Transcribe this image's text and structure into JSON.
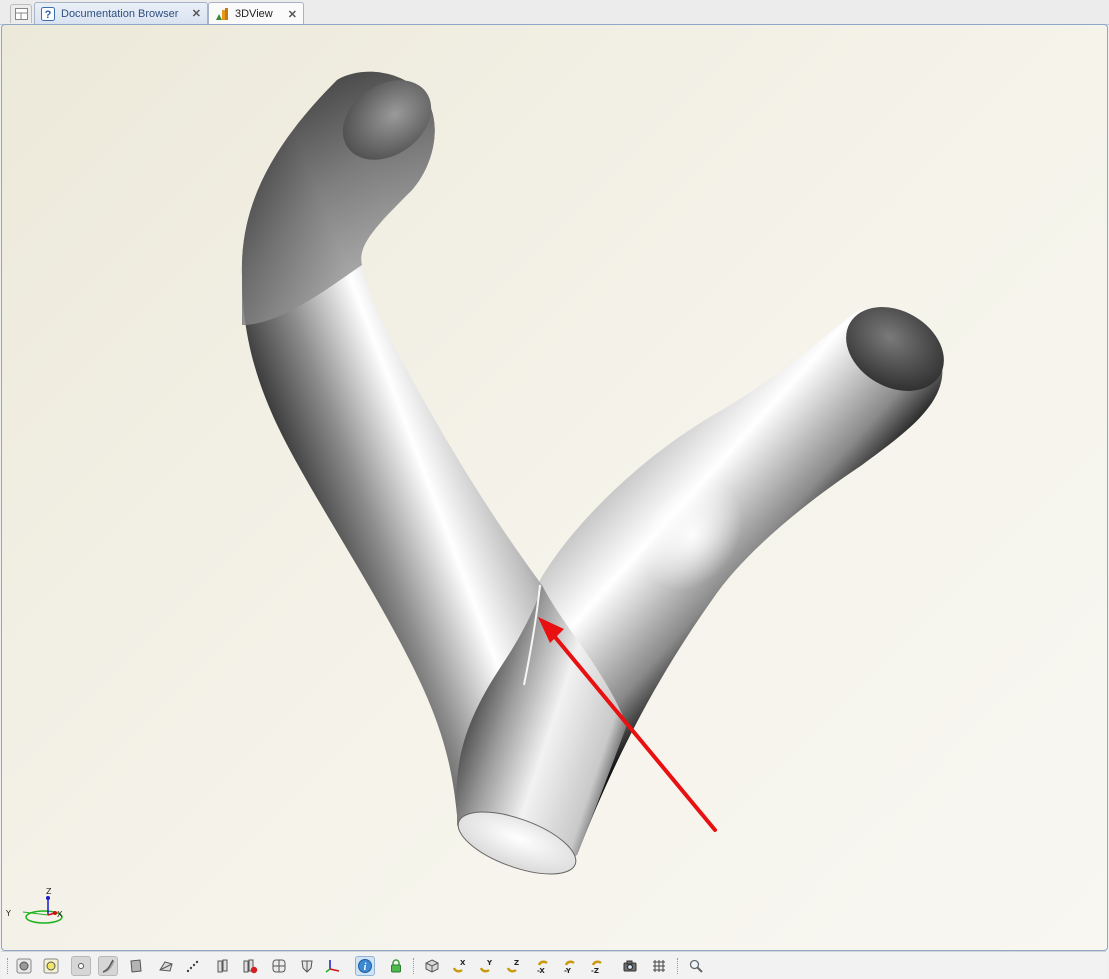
{
  "tabs": [
    {
      "label": "Documentation Browser",
      "icon": "help-icon",
      "active": false
    },
    {
      "label": "3DView",
      "icon": "chart-3d-icon",
      "active": true
    }
  ],
  "axis_triad": {
    "x": "X",
    "y": "Y",
    "z": "Z"
  },
  "toolbar": {
    "x_label": "X",
    "y_label": "Y",
    "z_label": "Z",
    "neg_x_label": "-X",
    "neg_y_label": "-Y",
    "neg_z_label": "-Z"
  },
  "colors": {
    "arrow": "#e81010",
    "viewport_border": "#8ea6c8"
  }
}
